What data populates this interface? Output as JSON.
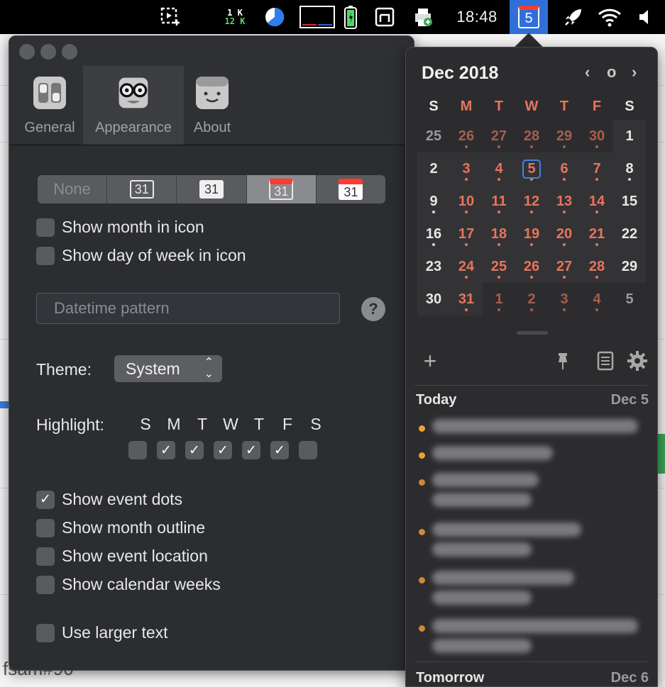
{
  "menubar": {
    "net_up": "1 K",
    "net_down": "12 K",
    "clock": "18:48",
    "calendar_day": "5"
  },
  "background_app": {
    "bottom_text": "fsam#90"
  },
  "prefs": {
    "tabs": [
      {
        "label": "General",
        "icon": "toggle-switches-icon",
        "active": false
      },
      {
        "label": "Appearance",
        "icon": "glasses-face-icon",
        "active": true
      },
      {
        "label": "About",
        "icon": "smiley-face-icon",
        "active": false
      }
    ],
    "icon_style": {
      "none_label": "None",
      "sample_day": "31"
    },
    "show_month_in_icon": {
      "label": "Show month in icon",
      "checked": false
    },
    "show_day_of_week_in_icon": {
      "label": "Show day of week in icon",
      "checked": false
    },
    "datetime_pattern": {
      "placeholder": "Datetime pattern",
      "value": ""
    },
    "help_label": "?",
    "theme": {
      "label": "Theme:",
      "value": "System"
    },
    "highlight": {
      "label": "Highlight:",
      "days": [
        "S",
        "M",
        "T",
        "W",
        "T",
        "F",
        "S"
      ],
      "checked": [
        false,
        true,
        true,
        true,
        true,
        true,
        false
      ]
    },
    "options": [
      {
        "label": "Show event dots",
        "checked": true
      },
      {
        "label": "Show month outline",
        "checked": false
      },
      {
        "label": "Show event location",
        "checked": false
      },
      {
        "label": "Show calendar weeks",
        "checked": false
      }
    ],
    "larger_text": {
      "label": "Use larger text",
      "checked": false
    }
  },
  "calendar": {
    "month_label": "Dec 2018",
    "nav": {
      "prev": "‹",
      "today": "o",
      "next": "›"
    },
    "weekday_headers": [
      "S",
      "M",
      "T",
      "W",
      "T",
      "F",
      "S"
    ],
    "weeks": [
      [
        {
          "d": "25",
          "cur": false,
          "dot": false
        },
        {
          "d": "26",
          "cur": false,
          "dot": true
        },
        {
          "d": "27",
          "cur": false,
          "dot": true
        },
        {
          "d": "28",
          "cur": false,
          "dot": true
        },
        {
          "d": "29",
          "cur": false,
          "dot": true
        },
        {
          "d": "30",
          "cur": false,
          "dot": true
        },
        {
          "d": "1",
          "cur": true,
          "dot": false
        }
      ],
      [
        {
          "d": "2",
          "cur": true,
          "dot": false
        },
        {
          "d": "3",
          "cur": true,
          "dot": true
        },
        {
          "d": "4",
          "cur": true,
          "dot": true
        },
        {
          "d": "5",
          "cur": true,
          "dot": true,
          "today": true
        },
        {
          "d": "6",
          "cur": true,
          "dot": true
        },
        {
          "d": "7",
          "cur": true,
          "dot": true
        },
        {
          "d": "8",
          "cur": true,
          "dot": true
        }
      ],
      [
        {
          "d": "9",
          "cur": true,
          "dot": true
        },
        {
          "d": "10",
          "cur": true,
          "dot": true
        },
        {
          "d": "11",
          "cur": true,
          "dot": true
        },
        {
          "d": "12",
          "cur": true,
          "dot": true
        },
        {
          "d": "13",
          "cur": true,
          "dot": true
        },
        {
          "d": "14",
          "cur": true,
          "dot": true
        },
        {
          "d": "15",
          "cur": true,
          "dot": false
        }
      ],
      [
        {
          "d": "16",
          "cur": true,
          "dot": true
        },
        {
          "d": "17",
          "cur": true,
          "dot": true
        },
        {
          "d": "18",
          "cur": true,
          "dot": true
        },
        {
          "d": "19",
          "cur": true,
          "dot": true
        },
        {
          "d": "20",
          "cur": true,
          "dot": true
        },
        {
          "d": "21",
          "cur": true,
          "dot": true
        },
        {
          "d": "22",
          "cur": true,
          "dot": false
        }
      ],
      [
        {
          "d": "23",
          "cur": true,
          "dot": false
        },
        {
          "d": "24",
          "cur": true,
          "dot": true
        },
        {
          "d": "25",
          "cur": true,
          "dot": true
        },
        {
          "d": "26",
          "cur": true,
          "dot": true
        },
        {
          "d": "27",
          "cur": true,
          "dot": true
        },
        {
          "d": "28",
          "cur": true,
          "dot": true
        },
        {
          "d": "29",
          "cur": true,
          "dot": false
        }
      ],
      [
        {
          "d": "30",
          "cur": true,
          "dot": false
        },
        {
          "d": "31",
          "cur": true,
          "dot": true
        },
        {
          "d": "1",
          "cur": false,
          "dot": true
        },
        {
          "d": "2",
          "cur": false,
          "dot": true
        },
        {
          "d": "3",
          "cur": false,
          "dot": true
        },
        {
          "d": "4",
          "cur": false,
          "dot": true
        },
        {
          "d": "5",
          "cur": false,
          "dot": false
        }
      ]
    ],
    "tools": {
      "add": "+",
      "pin": "pin-icon",
      "notes": "notes-icon",
      "settings": "gear-icon"
    },
    "agenda": [
      {
        "heading": "Today",
        "date": "Dec 5"
      },
      {
        "heading": "Tomorrow",
        "date": "Dec 6"
      }
    ]
  },
  "colors": {
    "accent_blue": "#2f6fd8",
    "weekday_red": "#e8745c",
    "event_orange": "#f0a030",
    "event_brown": "#c98a3a"
  }
}
